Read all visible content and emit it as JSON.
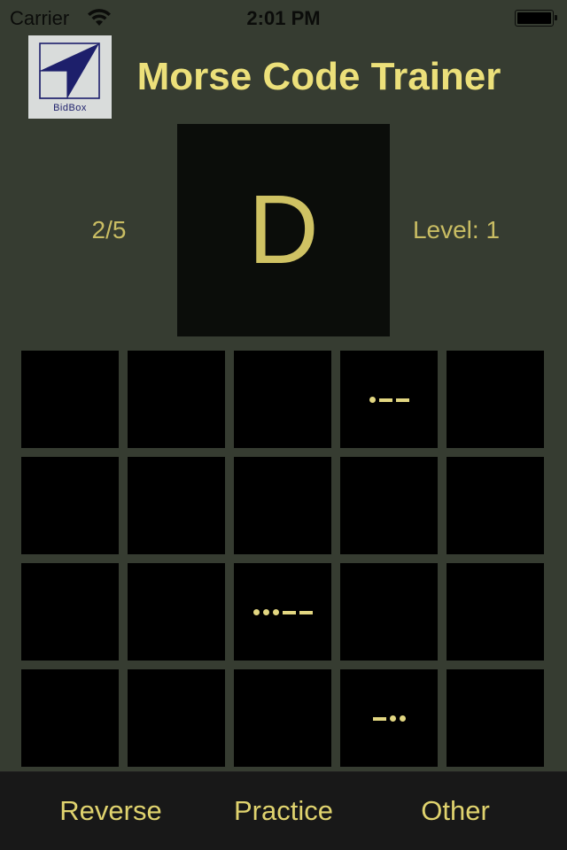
{
  "status_bar": {
    "carrier": "Carrier",
    "time": "2:01 PM",
    "wifi_icon": "wifi-icon",
    "battery_icon": "battery-icon",
    "battery_level": 1.0
  },
  "header": {
    "logo_text": "BidBox",
    "logo_icon": "bidbox-arrow-logo",
    "title": "Morse Code Trainer"
  },
  "quiz": {
    "progress": "2/5",
    "current_letter": "D",
    "level": "Level: 1"
  },
  "grid": {
    "rows": 4,
    "cols": 5,
    "cells": [
      "",
      "",
      "",
      ".--",
      "",
      "",
      "",
      "",
      "",
      "",
      "",
      "",
      "...--",
      "",
      "",
      "",
      "",
      "",
      "-..",
      ""
    ]
  },
  "tab_bar": {
    "tabs": [
      {
        "label": "Reverse"
      },
      {
        "label": "Practice"
      },
      {
        "label": "Other"
      }
    ]
  },
  "colors": {
    "background": "#363c31",
    "accent_text": "#e0d36e",
    "cell": "#000000",
    "letter_box": "#0b0d0a",
    "tab_bar": "#181818"
  }
}
